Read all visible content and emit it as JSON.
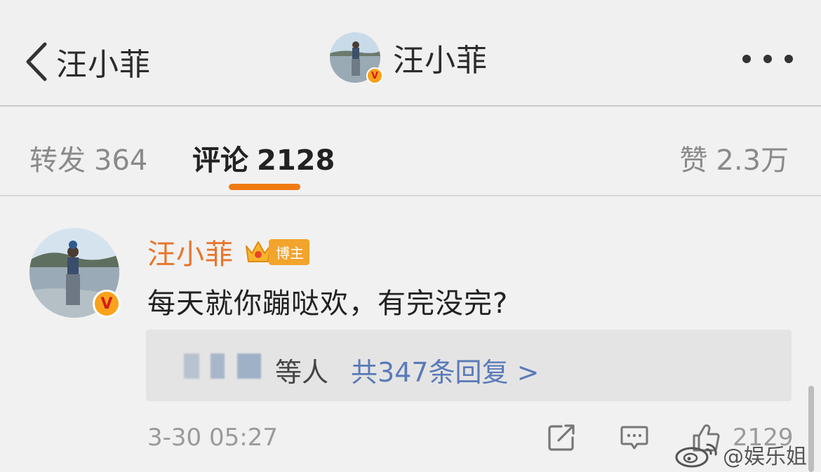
{
  "header": {
    "back_label": "汪小菲",
    "title": "汪小菲"
  },
  "tabs": {
    "repost": {
      "label": "转发",
      "count": "364"
    },
    "comments": {
      "label": "评论",
      "count": "2128"
    },
    "likes": {
      "label": "赞",
      "count": "2.3万"
    }
  },
  "comment": {
    "username": "汪小菲",
    "badge_label": "博主",
    "text": "每天就你蹦哒欢，有完没完?",
    "reply_suffix": "等人",
    "reply_count_text": "共347条回复 >",
    "timestamp": "3-30 05:27",
    "like_count": "2129"
  },
  "verified_badge": "V",
  "watermark": "@娱乐姐",
  "colors": {
    "accent": "#f07a12",
    "username": "#e8742a",
    "link": "#5a7ab8",
    "badge": "#f2a42c"
  },
  "icons": [
    "back-chevron-icon",
    "more-dots-icon",
    "crown-icon",
    "share-icon",
    "comment-icon",
    "thumbs-up-icon",
    "weibo-logo-icon"
  ]
}
